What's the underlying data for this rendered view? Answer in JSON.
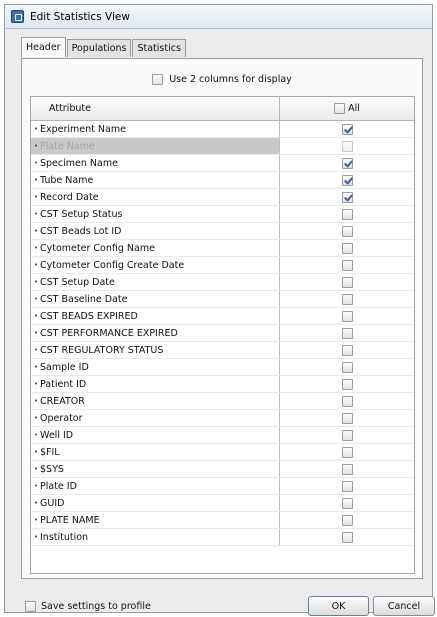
{
  "window": {
    "title": "Edit Statistics View"
  },
  "tabs": [
    {
      "label": "Header",
      "active": true
    },
    {
      "label": "Populations",
      "active": false
    },
    {
      "label": "Statistics",
      "active": false
    }
  ],
  "two_columns": {
    "label": "Use 2 columns for display",
    "checked": false
  },
  "table": {
    "columns": {
      "attribute": "Attribute",
      "all": "All"
    },
    "rows": [
      {
        "label": "Experiment Name",
        "checked": true,
        "disabled": false
      },
      {
        "label": "Plate Name",
        "checked": false,
        "disabled": true
      },
      {
        "label": "Specimen Name",
        "checked": true,
        "disabled": false
      },
      {
        "label": "Tube Name",
        "checked": true,
        "disabled": false
      },
      {
        "label": "Record Date",
        "checked": true,
        "disabled": false
      },
      {
        "label": "CST Setup Status",
        "checked": false,
        "disabled": false
      },
      {
        "label": "CST Beads Lot ID",
        "checked": false,
        "disabled": false
      },
      {
        "label": "Cytometer Config Name",
        "checked": false,
        "disabled": false
      },
      {
        "label": "Cytometer Config Create Date",
        "checked": false,
        "disabled": false
      },
      {
        "label": "CST Setup Date",
        "checked": false,
        "disabled": false
      },
      {
        "label": "CST Baseline Date",
        "checked": false,
        "disabled": false
      },
      {
        "label": "CST BEADS EXPIRED",
        "checked": false,
        "disabled": false
      },
      {
        "label": "CST PERFORMANCE EXPIRED",
        "checked": false,
        "disabled": false
      },
      {
        "label": "CST REGULATORY STATUS",
        "checked": false,
        "disabled": false
      },
      {
        "label": "Sample ID",
        "checked": false,
        "disabled": false
      },
      {
        "label": "Patient ID",
        "checked": false,
        "disabled": false
      },
      {
        "label": "CREATOR",
        "checked": false,
        "disabled": false
      },
      {
        "label": "Operator",
        "checked": false,
        "disabled": false
      },
      {
        "label": "Well ID",
        "checked": false,
        "disabled": false
      },
      {
        "label": "$FIL",
        "checked": false,
        "disabled": false
      },
      {
        "label": "$SYS",
        "checked": false,
        "disabled": false
      },
      {
        "label": "Plate ID",
        "checked": false,
        "disabled": false
      },
      {
        "label": "GUID",
        "checked": false,
        "disabled": false
      },
      {
        "label": "PLATE NAME",
        "checked": false,
        "disabled": false
      },
      {
        "label": "Institution",
        "checked": false,
        "disabled": false
      }
    ]
  },
  "footer": {
    "save_settings_label": "Save settings to profile",
    "ok_label": "OK",
    "cancel_label": "Cancel"
  }
}
